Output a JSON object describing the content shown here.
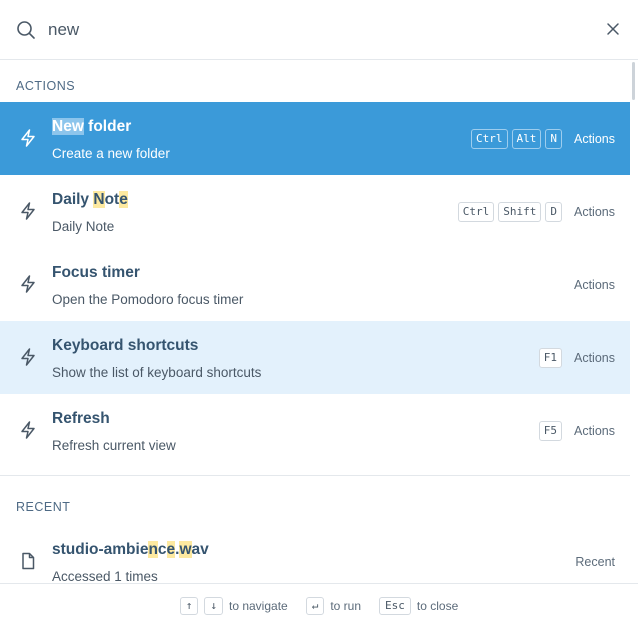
{
  "search": {
    "value": "new",
    "placeholder": ""
  },
  "sections": {
    "actions": "ACTIONS",
    "recent": "RECENT"
  },
  "actions": [
    {
      "title_parts": [
        {
          "t": "New",
          "h": true
        },
        {
          "t": " folder",
          "h": false
        }
      ],
      "subtitle": "Create a new folder",
      "keys": [
        "Ctrl",
        "Alt",
        "N"
      ],
      "category": "Actions",
      "icon": "lightning-icon"
    },
    {
      "title_parts": [
        {
          "t": "Daily ",
          "h": false
        },
        {
          "t": "N",
          "h": true
        },
        {
          "t": "ot",
          "h": false
        },
        {
          "t": "e",
          "h": true
        }
      ],
      "subtitle": "Daily Note",
      "keys": [
        "Ctrl",
        "Shift",
        "D"
      ],
      "category": "Actions",
      "icon": "lightning-icon"
    },
    {
      "title_parts": [
        {
          "t": "Focus timer",
          "h": false
        }
      ],
      "subtitle": "Open the Pomodoro focus timer",
      "keys": [],
      "category": "Actions",
      "icon": "lightning-icon"
    },
    {
      "title_parts": [
        {
          "t": "Keyboard shortcuts",
          "h": false
        }
      ],
      "subtitle": "Show the list of keyboard shortcuts",
      "keys": [
        "F1"
      ],
      "category": "Actions",
      "icon": "lightning-icon"
    },
    {
      "title_parts": [
        {
          "t": "Refresh",
          "h": false
        }
      ],
      "subtitle": "Refresh current view",
      "keys": [
        "F5"
      ],
      "category": "Actions",
      "icon": "lightning-icon"
    }
  ],
  "recent": [
    {
      "title_parts": [
        {
          "t": "studio-ambie",
          "h": false
        },
        {
          "t": "n",
          "h": true
        },
        {
          "t": "c",
          "h": false
        },
        {
          "t": "e",
          "h": true
        },
        {
          "t": ".",
          "h": false
        },
        {
          "t": "w",
          "h": true
        },
        {
          "t": "av",
          "h": false
        }
      ],
      "subtitle": "Accessed 1 times",
      "keys": [],
      "category": "Recent",
      "icon": "file-icon"
    }
  ],
  "footer": {
    "up_key": "↑",
    "down_key": "↓",
    "navigate": "to navigate",
    "enter_key": "↵",
    "run": "to run",
    "esc_key": "Esc",
    "close": "to close"
  },
  "colors": {
    "selected": "#3b9ad9",
    "hover": "#e3f1fc",
    "highlight": "#fde9a0",
    "title": "#35546f"
  }
}
